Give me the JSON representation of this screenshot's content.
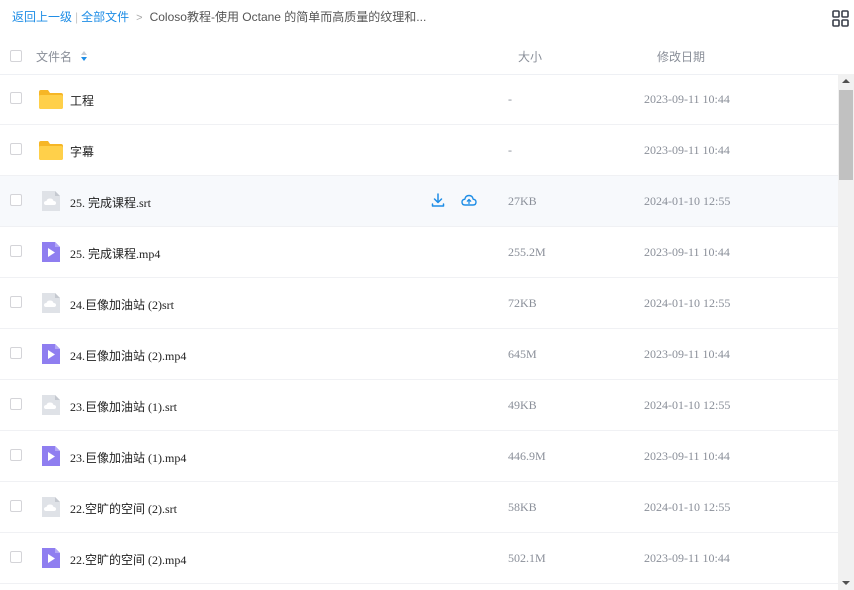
{
  "breadcrumb": {
    "back": "返回上一级",
    "root": "全部文件",
    "current": "Coloso教程-使用 Octane 的简单而高质量的纹理和..."
  },
  "view_toggle_icon": "grid-icon",
  "header": {
    "name": "文件名",
    "size": "大小",
    "date": "修改日期"
  },
  "colors": {
    "accent": "#1e8de6",
    "folder": "#ffc933",
    "video": "#8f7ef0",
    "doc": "#c9cdd4"
  },
  "files": [
    {
      "type": "folder",
      "icon": "folder-icon",
      "name": "工程",
      "size": "-",
      "date": "2023-09-11 10:44"
    },
    {
      "type": "folder",
      "icon": "folder-icon",
      "name": "字幕",
      "size": "-",
      "date": "2023-09-11 10:44"
    },
    {
      "type": "srt",
      "icon": "cloud-file-icon",
      "name": "25. 完成课程.srt",
      "size": "27KB",
      "date": "2024-01-10 12:55",
      "hover": true,
      "actions": [
        "download-icon",
        "cloud-save-icon"
      ]
    },
    {
      "type": "video",
      "icon": "video-file-icon",
      "name": "25. 完成课程.mp4",
      "size": "255.2M",
      "date": "2023-09-11 10:44"
    },
    {
      "type": "srt",
      "icon": "cloud-file-icon",
      "name": "24.巨像加油站 (2)srt",
      "size": "72KB",
      "date": "2024-01-10 12:55"
    },
    {
      "type": "video",
      "icon": "video-file-icon",
      "name": "24.巨像加油站 (2).mp4",
      "size": "645M",
      "date": "2023-09-11 10:44"
    },
    {
      "type": "srt",
      "icon": "cloud-file-icon",
      "name": "23.巨像加油站 (1).srt",
      "size": "49KB",
      "date": "2024-01-10 12:55"
    },
    {
      "type": "video",
      "icon": "video-file-icon",
      "name": "23.巨像加油站 (1).mp4",
      "size": "446.9M",
      "date": "2023-09-11 10:44"
    },
    {
      "type": "srt",
      "icon": "cloud-file-icon",
      "name": "22.空旷的空间 (2).srt",
      "size": "58KB",
      "date": "2024-01-10 12:55"
    },
    {
      "type": "video",
      "icon": "video-file-icon",
      "name": "22.空旷的空间 (2).mp4",
      "size": "502.1M",
      "date": "2023-09-11 10:44"
    }
  ]
}
